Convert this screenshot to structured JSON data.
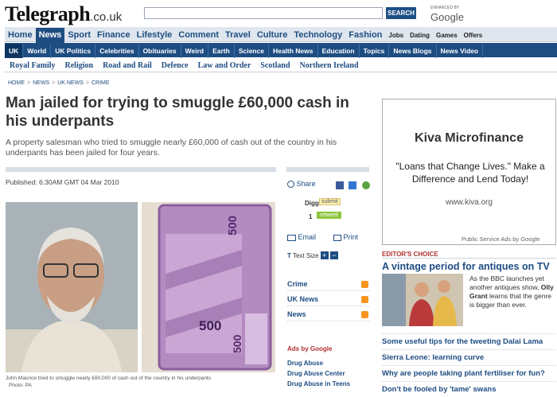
{
  "brand": {
    "logo": "Telegraph",
    "domain": ".co.uk"
  },
  "search": {
    "button": "SEARCH",
    "enhanced": "ENHANCED BY",
    "google": "Google"
  },
  "nav_main": [
    "Home",
    "News",
    "Sport",
    "Finance",
    "Lifestyle",
    "Comment",
    "Travel",
    "Culture",
    "Technology",
    "Fashion"
  ],
  "nav_main_active": "News",
  "nav_small": [
    "Jobs",
    "Dating",
    "Games",
    "Offers"
  ],
  "nav_sub": [
    "UK",
    "World",
    "UK Politics",
    "Celebrities",
    "Obituaries",
    "Weird",
    "Earth",
    "Science",
    "Health News",
    "Education",
    "Topics",
    "News Blogs",
    "News Video"
  ],
  "nav_sub_active": "UK",
  "nav_third": [
    "Royal Family",
    "Religion",
    "Road and Rail",
    "Defence",
    "Law and Order",
    "Scotland",
    "Northern Ireland"
  ],
  "breadcrumb": [
    "HOME",
    "NEWS",
    "UK NEWS",
    "CRIME"
  ],
  "article": {
    "headline": "Man jailed for trying to smuggle £60,000 cash in his underpants",
    "standfirst": "A property salesman who tried to smuggle nearly £60,000 of cash out of the country in his underpants has been jailed for four years.",
    "published": "Published: 6:30AM GMT 04 Mar 2010",
    "caption": "John Maurice tried to smuggle nearly £60,000 of cash out of the country in his underpants",
    "photo_credit": "Photo: PA",
    "note_value": "500"
  },
  "tools": {
    "share": "Share",
    "digg": "Digg",
    "submit": "submit",
    "count": "1",
    "retweet": "retweet",
    "email": "Email",
    "print": "Print",
    "textsize": "Text Size"
  },
  "feeds": [
    "Crime",
    "UK News",
    "News"
  ],
  "ads_by": "Ads by Google",
  "ad_links": [
    "Drug Abuse",
    "Drug Abuse Center",
    "Drug Abuse in Teens"
  ],
  "advert": {
    "title": "Kiva Microfinance",
    "slogan": "\"Loans that Change Lives.\" Make a Difference and Lend Today!",
    "url": "www.kiva.org",
    "psa": "Public Service Ads by Google"
  },
  "editors_choice": {
    "label": "EDITOR'S CHOICE",
    "headline": "A vintage period for antiques on TV",
    "text_pre": "As the BBC launches yet another antiques show, ",
    "name": "Olly Grant",
    "text_post": " learns that the genre is bigger than ever."
  },
  "right_links": [
    "Some useful tips for the tweeting Dalai Lama",
    "Sierra Leone: learning curve",
    "Why are people taking plant fertiliser for fun?",
    "Don't be fooled by 'tame' swans"
  ],
  "colors": {
    "navy": "#1e4d82",
    "red": "#b03030",
    "rss": "#f7941d",
    "retweet": "#8cc63f"
  }
}
